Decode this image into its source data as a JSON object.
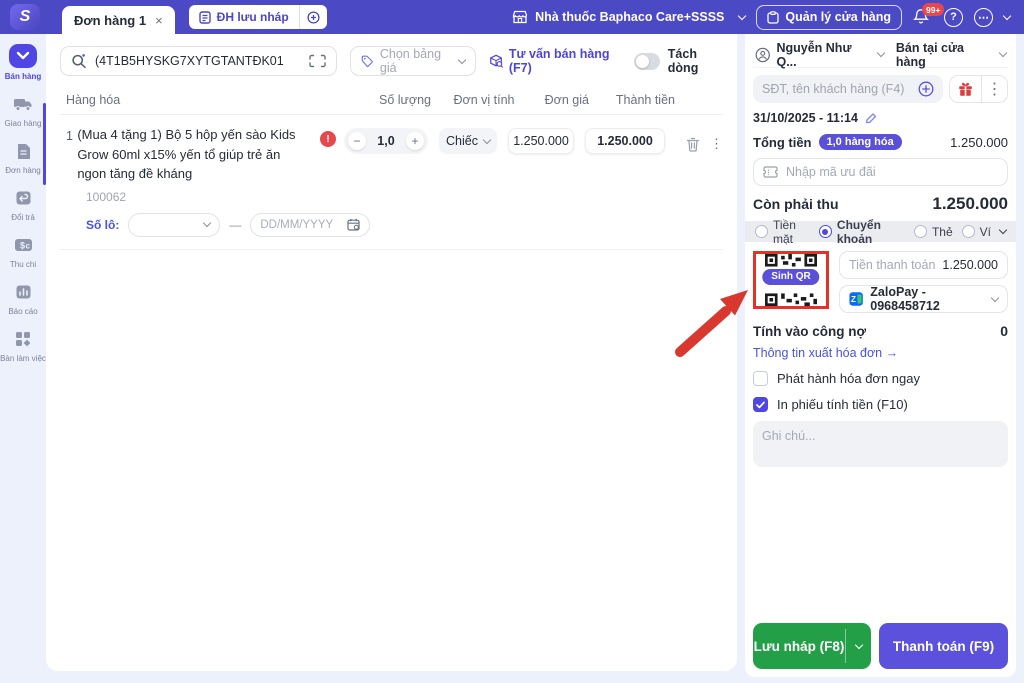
{
  "topbar": {
    "tab_label": "Đơn hàng 1",
    "tab_close": "×",
    "draft_orders_button": "ĐH lưu nháp",
    "store_name": "Nhà thuốc Baphaco Care+SSSS",
    "manage_store_button": "Quản lý cửa hàng",
    "notifications_badge": "99+",
    "help_glyph": "?",
    "more_glyph": "⋯"
  },
  "sidebar": {
    "items": [
      {
        "label": "Bán hàng",
        "active": true
      },
      {
        "label": "Giao hàng",
        "active": false
      },
      {
        "label": "Đơn hàng",
        "active": false
      },
      {
        "label": "Đổi trả",
        "active": false
      },
      {
        "label": "Thu chi",
        "active": false
      },
      {
        "label": "Báo cáo",
        "active": false
      },
      {
        "label": "Bàn làm việc",
        "active": false
      }
    ]
  },
  "toolbar": {
    "search_value": "(4T1B5HYSKG7XYTGTANTĐK01",
    "price_list_placeholder": "Chọn bảng giá",
    "consult_button": "Tư vấn bán hàng (F7)",
    "split_line_toggle": "Tách dòng"
  },
  "order_table": {
    "headers": [
      "Hàng hóa",
      "Số lượng",
      "Đơn vị tính",
      "Đơn giá",
      "Thành tiền"
    ],
    "row": {
      "index": "1",
      "name": "(Mua 4 tặng 1) Bộ 5 hộp yến sào Kids Grow 60ml x15% yến tổ giúp trẻ ăn ngon tăng đề kháng",
      "alert_glyph": "!",
      "sku": "100062",
      "lot_label": "Số lô:",
      "range_dash": "—",
      "expiry_placeholder": "DD/MM/YYYY",
      "minus": "−",
      "quantity": "1,0",
      "plus": "+",
      "unit": "Chiếc",
      "unit_price": "1.250.000",
      "line_total": "1.250.000",
      "kebab_glyph": "⋮"
    }
  },
  "checkout": {
    "staff_name": "Nguyễn Như Q...",
    "sale_channel": "Bán tại cửa hàng",
    "customer_placeholder": "SĐT, tên khách hàng (F4)",
    "kebab_glyph": "⋮",
    "order_datetime": "31/10/2025 - 11:14",
    "total_label": "Tổng tiền",
    "total_badge": "1,0 hàng hóa",
    "total_value": "1.250.000",
    "promo_placeholder": "Nhập mã ưu đãi",
    "remaining_label": "Còn phải thu",
    "remaining_value": "1.250.000",
    "payment_methods": [
      "Tiền mặt",
      "Chuyển khoản",
      "Thẻ",
      "Ví"
    ],
    "selected_method": "Chuyển khoản",
    "qr_button": "Sinh QR",
    "payment_amount_label": "Tiền thanh toán",
    "payment_amount_value": "1.250.000",
    "wallet_account": "ZaloPay - 0968458712",
    "debt_label": "Tính vào công nợ",
    "debt_value": "0",
    "invoice_info_link": "Thông tin xuất hóa đơn →",
    "issue_invoice_checkbox": "Phát hành hóa đơn ngay",
    "print_receipt_checkbox": "In phiếu tính tiền (F10)",
    "note_placeholder": "Ghi chú...",
    "save_draft_button": "Lưu nháp (F8)",
    "pay_button": "Thanh toán (F9)"
  },
  "colors": {
    "topbar": "#4C49C5",
    "accent": "#4F46E5",
    "green": "#23A047",
    "badge_red": "#E5484D",
    "annotation_red": "#E0342B"
  }
}
